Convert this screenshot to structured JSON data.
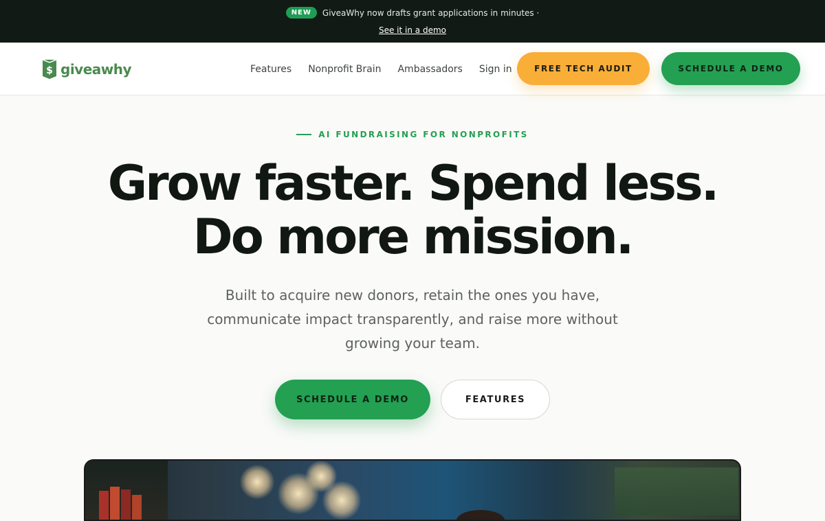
{
  "announcement": {
    "badge": "NEW",
    "text": "GiveaWhy now drafts grant applications in minutes ·",
    "link": "See it in a demo"
  },
  "nav": {
    "logo_text": "giveawhy",
    "links": [
      "Features",
      "Nonprofit Brain",
      "Ambassadors",
      "Sign in"
    ],
    "audit_button": "FREE TECH AUDIT",
    "demo_button": "SCHEDULE A DEMO"
  },
  "hero": {
    "eyebrow": "AI FUNDRAISING FOR NONPROFITS",
    "headline_line1": "Grow faster. Spend less.",
    "headline_line2": "Do more mission.",
    "subhead": "Built to acquire new donors, retain the ones you have, communicate impact transparently, and raise more without growing your team.",
    "primary_cta": "SCHEDULE A DEMO",
    "secondary_cta": "FEATURES"
  },
  "colors": {
    "brand_green": "#23a052",
    "accent_orange": "#f9ae38",
    "dark_bar": "#111a14"
  }
}
